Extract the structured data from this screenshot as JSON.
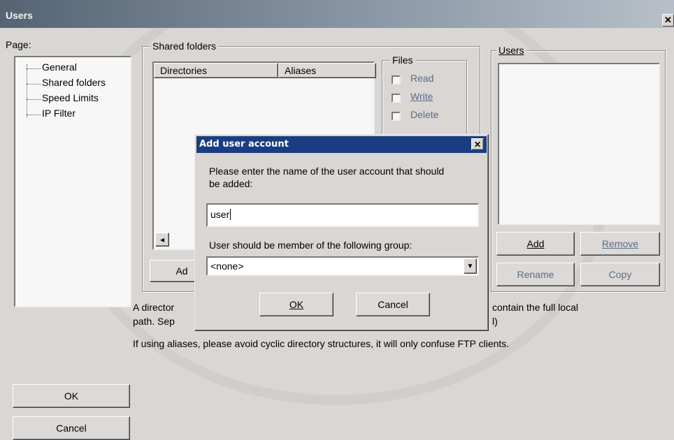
{
  "window": {
    "title": "Users",
    "close_glyph": "✕"
  },
  "page_section": {
    "label": "Page:",
    "tree_items": [
      "General",
      "Shared folders",
      "Speed Limits",
      "IP Filter"
    ]
  },
  "shared_folders": {
    "group_label": "Shared folders",
    "columns": [
      "Directories",
      "Aliases"
    ],
    "files_group": {
      "label": "Files",
      "options": [
        "Read",
        "Write",
        "Delete"
      ]
    },
    "add_button_partial": "Ad",
    "scroll_left_glyph": "◂"
  },
  "users_panel": {
    "group_label": "Users",
    "add_label": "Add",
    "remove_label": "Remove",
    "rename_label": "Rename",
    "copy_label": "Copy"
  },
  "info_text": {
    "line1_left": "A director",
    "line1_right": "contain the full local",
    "line2_left": "path. Sep",
    "line2_right": "l)",
    "line3": "If using aliases, please avoid cyclic directory structures, it will only confuse FTP clients."
  },
  "main_buttons": {
    "ok": "OK",
    "cancel": "Cancel"
  },
  "dialog": {
    "title": "Add user account",
    "close_glyph": "✕",
    "prompt_line1": "Please enter the name of the user account that should",
    "prompt_line2": "be added:",
    "name_value": "user",
    "group_prompt": "User should be member of the following group:",
    "group_selected": "<none>",
    "dropdown_glyph": "▼",
    "ok_label": "OK",
    "cancel_label": "Cancel"
  },
  "colors": {
    "titlebar_start": "#556474",
    "dialog_title": "#1a3d82",
    "disabled_text": "#5b6c8a"
  }
}
